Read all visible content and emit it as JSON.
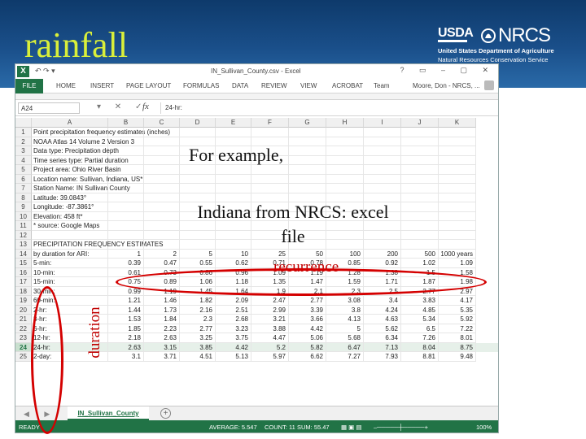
{
  "slide": {
    "title": "rainfall"
  },
  "logo": {
    "usda": "USDA",
    "nrcs": "NRCS",
    "line1": "United States Department of Agriculture",
    "line2": "Natural Resources Conservation Service"
  },
  "excel": {
    "title": "IN_Sullivan_County.csv - Excel",
    "quick_access": "↶ ↷ ▾",
    "window_buttons": "? ▭ – ▢ ✕",
    "tabs": [
      "FILE",
      "HOME",
      "INSERT",
      "PAGE LAYOUT",
      "FORMULAS",
      "DATA",
      "REVIEW",
      "VIEW",
      "ACROBAT",
      "Team"
    ],
    "user": "Moore, Don - NRCS, ...",
    "name_box": "A24",
    "formula_buttons": "▾ ✕ ✓",
    "fx": "fx",
    "formula": "24-hr:",
    "columns": [
      "A",
      "B",
      "C",
      "D",
      "E",
      "F",
      "G",
      "H",
      "I",
      "J",
      "K"
    ],
    "rows": [
      {
        "n": "1",
        "a": "Point precipitation frequency estimates (inches)"
      },
      {
        "n": "2",
        "a": "NOAA Atlas 14 Volume 2 Version 3"
      },
      {
        "n": "3",
        "a": "Data type: Precipitation depth"
      },
      {
        "n": "4",
        "a": "Time series type: Partial duration"
      },
      {
        "n": "5",
        "a": "Project area: Ohio River Basin"
      },
      {
        "n": "6",
        "a": "Location name: Sullivan, Indiana, US*"
      },
      {
        "n": "7",
        "a": "Station Name: IN Sullivan County"
      },
      {
        "n": "8",
        "a": "Latitude: 39.0843°"
      },
      {
        "n": "9",
        "a": "Longitude: -87.3861°"
      },
      {
        "n": "10",
        "a": "Elevation: 458 ft*"
      },
      {
        "n": "11",
        "a": "* source: Google Maps"
      },
      {
        "n": "12",
        "a": ""
      },
      {
        "n": "13",
        "a": "PRECIPITATION FREQUENCY ESTIMATES"
      },
      {
        "n": "14",
        "a": "by duration for ARI:",
        "v": [
          "1",
          "2",
          "5",
          "10",
          "25",
          "50",
          "100",
          "200",
          "500",
          "1000 years"
        ]
      },
      {
        "n": "15",
        "a": "5-min:",
        "v": [
          "0.39",
          "0.47",
          "0.55",
          "0.62",
          "0.71",
          "0.78",
          "0.85",
          "0.92",
          "1.02",
          "1.09"
        ]
      },
      {
        "n": "16",
        "a": "10-min:",
        "v": [
          "0.61",
          "0.73",
          "0.86",
          "0.96",
          "1.09",
          "1.19",
          "1.28",
          "1.38",
          "1.5",
          "1.58"
        ]
      },
      {
        "n": "17",
        "a": "15-min:",
        "v": [
          "0.75",
          "0.89",
          "1.06",
          "1.18",
          "1.35",
          "1.47",
          "1.59",
          "1.71",
          "1.87",
          "1.98"
        ]
      },
      {
        "n": "18",
        "a": "30-min:",
        "v": [
          "0.99",
          "1.19",
          "1.45",
          "1.64",
          "1.9",
          "2.1",
          "2.3",
          "2.5",
          "2.77",
          "2.97"
        ]
      },
      {
        "n": "19",
        "a": "60-min:",
        "v": [
          "1.21",
          "1.46",
          "1.82",
          "2.09",
          "2.47",
          "2.77",
          "3.08",
          "3.4",
          "3.83",
          "4.17"
        ]
      },
      {
        "n": "20",
        "a": "2-hr:",
        "v": [
          "1.44",
          "1.73",
          "2.16",
          "2.51",
          "2.99",
          "3.39",
          "3.8",
          "4.24",
          "4.85",
          "5.35"
        ]
      },
      {
        "n": "21",
        "a": "3-hr:",
        "v": [
          "1.53",
          "1.84",
          "2.3",
          "2.68",
          "3.21",
          "3.66",
          "4.13",
          "4.63",
          "5.34",
          "5.92"
        ]
      },
      {
        "n": "22",
        "a": "6-hr:",
        "v": [
          "1.85",
          "2.23",
          "2.77",
          "3.23",
          "3.88",
          "4.42",
          "5",
          "5.62",
          "6.5",
          "7.22"
        ]
      },
      {
        "n": "23",
        "a": "12-hr:",
        "v": [
          "2.18",
          "2.63",
          "3.25",
          "3.75",
          "4.47",
          "5.06",
          "5.68",
          "6.34",
          "7.26",
          "8.01"
        ]
      },
      {
        "n": "24",
        "a": "24-hr:",
        "v": [
          "2.63",
          "3.15",
          "3.85",
          "4.42",
          "5.2",
          "5.82",
          "6.47",
          "7.13",
          "8.04",
          "8.75"
        ],
        "sel": true
      },
      {
        "n": "25",
        "a": "2-day:",
        "v": [
          "3.1",
          "3.71",
          "4.51",
          "5.13",
          "5.97",
          "6.62",
          "7.27",
          "7.93",
          "8.81",
          "9.48"
        ]
      }
    ],
    "sheet_tab": "IN_Sullivan_County",
    "status": {
      "ready": "READY",
      "average": "AVERAGE: 5.547",
      "count": "COUNT: 11",
      "sum": "SUM: 55.47",
      "zoom": "100%"
    }
  },
  "annotations": {
    "example": "For example,",
    "source": "Indiana from NRCS: excel file",
    "recurrence": "recurrence",
    "duration": "duration"
  },
  "colors": {
    "excel_green": "#217346",
    "highlight_red": "#d40000",
    "title_yellow": "#d9ef3a"
  }
}
